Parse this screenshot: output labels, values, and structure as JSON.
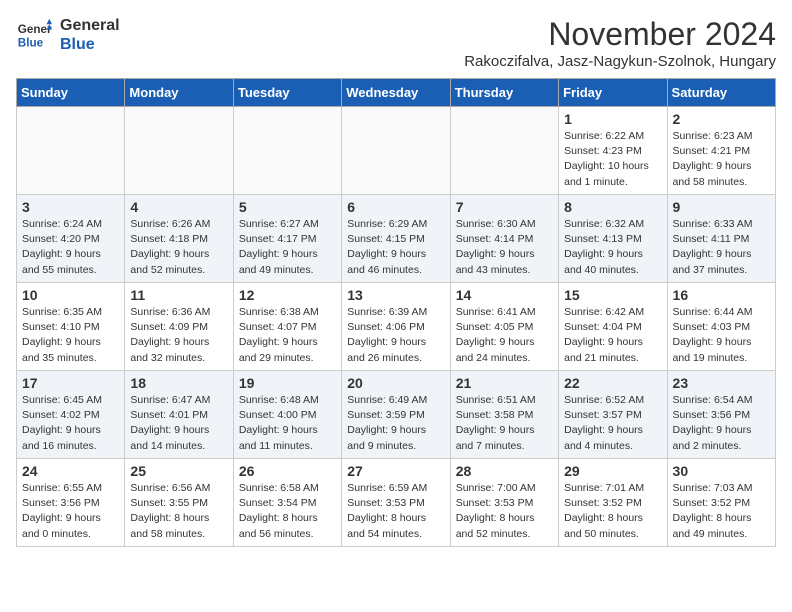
{
  "logo": {
    "line1": "General",
    "line2": "Blue"
  },
  "title": "November 2024",
  "subtitle": "Rakoczifalva, Jasz-Nagykun-Szolnok, Hungary",
  "days_of_week": [
    "Sunday",
    "Monday",
    "Tuesday",
    "Wednesday",
    "Thursday",
    "Friday",
    "Saturday"
  ],
  "weeks": [
    [
      {
        "day": "",
        "info": ""
      },
      {
        "day": "",
        "info": ""
      },
      {
        "day": "",
        "info": ""
      },
      {
        "day": "",
        "info": ""
      },
      {
        "day": "",
        "info": ""
      },
      {
        "day": "1",
        "info": "Sunrise: 6:22 AM\nSunset: 4:23 PM\nDaylight: 10 hours and 1 minute."
      },
      {
        "day": "2",
        "info": "Sunrise: 6:23 AM\nSunset: 4:21 PM\nDaylight: 9 hours and 58 minutes."
      }
    ],
    [
      {
        "day": "3",
        "info": "Sunrise: 6:24 AM\nSunset: 4:20 PM\nDaylight: 9 hours and 55 minutes."
      },
      {
        "day": "4",
        "info": "Sunrise: 6:26 AM\nSunset: 4:18 PM\nDaylight: 9 hours and 52 minutes."
      },
      {
        "day": "5",
        "info": "Sunrise: 6:27 AM\nSunset: 4:17 PM\nDaylight: 9 hours and 49 minutes."
      },
      {
        "day": "6",
        "info": "Sunrise: 6:29 AM\nSunset: 4:15 PM\nDaylight: 9 hours and 46 minutes."
      },
      {
        "day": "7",
        "info": "Sunrise: 6:30 AM\nSunset: 4:14 PM\nDaylight: 9 hours and 43 minutes."
      },
      {
        "day": "8",
        "info": "Sunrise: 6:32 AM\nSunset: 4:13 PM\nDaylight: 9 hours and 40 minutes."
      },
      {
        "day": "9",
        "info": "Sunrise: 6:33 AM\nSunset: 4:11 PM\nDaylight: 9 hours and 37 minutes."
      }
    ],
    [
      {
        "day": "10",
        "info": "Sunrise: 6:35 AM\nSunset: 4:10 PM\nDaylight: 9 hours and 35 minutes."
      },
      {
        "day": "11",
        "info": "Sunrise: 6:36 AM\nSunset: 4:09 PM\nDaylight: 9 hours and 32 minutes."
      },
      {
        "day": "12",
        "info": "Sunrise: 6:38 AM\nSunset: 4:07 PM\nDaylight: 9 hours and 29 minutes."
      },
      {
        "day": "13",
        "info": "Sunrise: 6:39 AM\nSunset: 4:06 PM\nDaylight: 9 hours and 26 minutes."
      },
      {
        "day": "14",
        "info": "Sunrise: 6:41 AM\nSunset: 4:05 PM\nDaylight: 9 hours and 24 minutes."
      },
      {
        "day": "15",
        "info": "Sunrise: 6:42 AM\nSunset: 4:04 PM\nDaylight: 9 hours and 21 minutes."
      },
      {
        "day": "16",
        "info": "Sunrise: 6:44 AM\nSunset: 4:03 PM\nDaylight: 9 hours and 19 minutes."
      }
    ],
    [
      {
        "day": "17",
        "info": "Sunrise: 6:45 AM\nSunset: 4:02 PM\nDaylight: 9 hours and 16 minutes."
      },
      {
        "day": "18",
        "info": "Sunrise: 6:47 AM\nSunset: 4:01 PM\nDaylight: 9 hours and 14 minutes."
      },
      {
        "day": "19",
        "info": "Sunrise: 6:48 AM\nSunset: 4:00 PM\nDaylight: 9 hours and 11 minutes."
      },
      {
        "day": "20",
        "info": "Sunrise: 6:49 AM\nSunset: 3:59 PM\nDaylight: 9 hours and 9 minutes."
      },
      {
        "day": "21",
        "info": "Sunrise: 6:51 AM\nSunset: 3:58 PM\nDaylight: 9 hours and 7 minutes."
      },
      {
        "day": "22",
        "info": "Sunrise: 6:52 AM\nSunset: 3:57 PM\nDaylight: 9 hours and 4 minutes."
      },
      {
        "day": "23",
        "info": "Sunrise: 6:54 AM\nSunset: 3:56 PM\nDaylight: 9 hours and 2 minutes."
      }
    ],
    [
      {
        "day": "24",
        "info": "Sunrise: 6:55 AM\nSunset: 3:56 PM\nDaylight: 9 hours and 0 minutes."
      },
      {
        "day": "25",
        "info": "Sunrise: 6:56 AM\nSunset: 3:55 PM\nDaylight: 8 hours and 58 minutes."
      },
      {
        "day": "26",
        "info": "Sunrise: 6:58 AM\nSunset: 3:54 PM\nDaylight: 8 hours and 56 minutes."
      },
      {
        "day": "27",
        "info": "Sunrise: 6:59 AM\nSunset: 3:53 PM\nDaylight: 8 hours and 54 minutes."
      },
      {
        "day": "28",
        "info": "Sunrise: 7:00 AM\nSunset: 3:53 PM\nDaylight: 8 hours and 52 minutes."
      },
      {
        "day": "29",
        "info": "Sunrise: 7:01 AM\nSunset: 3:52 PM\nDaylight: 8 hours and 50 minutes."
      },
      {
        "day": "30",
        "info": "Sunrise: 7:03 AM\nSunset: 3:52 PM\nDaylight: 8 hours and 49 minutes."
      }
    ]
  ]
}
